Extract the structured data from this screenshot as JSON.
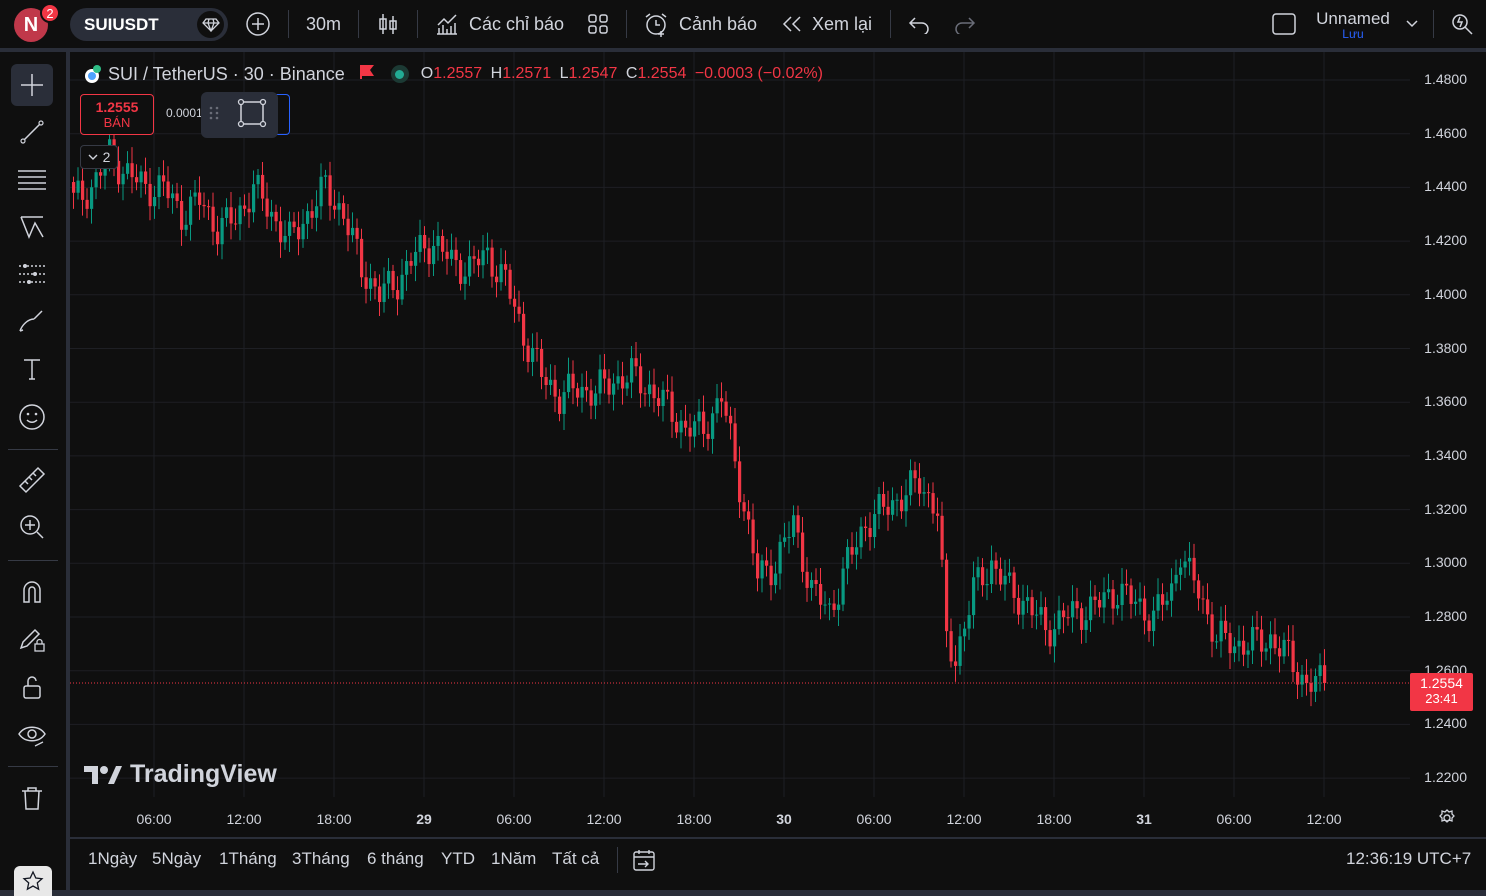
{
  "topbar": {
    "avatar_letter": "N",
    "notification_count": "2",
    "symbol": "SUIUSDT",
    "interval": "30m",
    "indicators_label": "Các chỉ báo",
    "alerts_label": "Cảnh báo",
    "replay_label": "Xem lại",
    "layout_name": "Unnamed",
    "save_label": "Lưu"
  },
  "legend": {
    "title": "SUI / TetherUS · 30 · Binance",
    "open_label": "O",
    "open": "1.2557",
    "high_label": "H",
    "high": "1.2571",
    "low_label": "L",
    "low": "1.2547",
    "close_label": "C",
    "close": "1.2554",
    "change": "−0.0003 (−0.02%)"
  },
  "trade": {
    "sell_price": "1.2555",
    "sell_label": "BÁN",
    "spread": "0.0001",
    "collapse_count": "2"
  },
  "price_axis": {
    "ticks": [
      "1.4800",
      "1.4600",
      "1.4400",
      "1.4200",
      "1.4000",
      "1.3800",
      "1.3600",
      "1.3400",
      "1.3200",
      "1.3000",
      "1.2800",
      "1.2600",
      "1.2400",
      "1.2200"
    ],
    "current_price": "1.2554",
    "countdown": "23:41"
  },
  "time_axis": {
    "ticks": [
      "06:00",
      "12:00",
      "18:00",
      "29",
      "06:00",
      "12:00",
      "18:00",
      "30",
      "06:00",
      "12:00",
      "18:00",
      "31",
      "06:00",
      "12:00"
    ]
  },
  "watermark": "TradingView",
  "bottombar": {
    "ranges": [
      "1Ngày",
      "5Ngày",
      "1Tháng",
      "3Tháng",
      "6 tháng",
      "YTD",
      "1Năm",
      "Tất cả"
    ],
    "clock": "12:36:19 UTC+7"
  },
  "colors": {
    "up": "#089981",
    "down": "#f23645",
    "background": "#0f0f0f",
    "accent": "#2962ff"
  },
  "chart_data": {
    "type": "candlestick",
    "ylim": [
      1.21,
      1.495
    ],
    "anchors": [
      [
        0,
        1.435
      ],
      [
        4,
        1.44
      ],
      [
        8,
        1.452
      ],
      [
        12,
        1.445
      ],
      [
        16,
        1.44
      ],
      [
        20,
        1.44
      ],
      [
        24,
        1.43
      ],
      [
        28,
        1.435
      ],
      [
        32,
        1.425
      ],
      [
        36,
        1.428
      ],
      [
        40,
        1.44
      ],
      [
        44,
        1.43
      ],
      [
        48,
        1.42
      ],
      [
        52,
        1.43
      ],
      [
        56,
        1.44
      ],
      [
        60,
        1.43
      ],
      [
        64,
        1.41
      ],
      [
        68,
        1.4
      ],
      [
        72,
        1.405
      ],
      [
        76,
        1.415
      ],
      [
        80,
        1.42
      ],
      [
        84,
        1.412
      ],
      [
        88,
        1.41
      ],
      [
        92,
        1.415
      ],
      [
        96,
        1.405
      ],
      [
        100,
        1.385
      ],
      [
        104,
        1.37
      ],
      [
        108,
        1.362
      ],
      [
        112,
        1.365
      ],
      [
        116,
        1.364
      ],
      [
        120,
        1.368
      ],
      [
        124,
        1.37
      ],
      [
        128,
        1.365
      ],
      [
        132,
        1.358
      ],
      [
        136,
        1.35
      ],
      [
        140,
        1.35
      ],
      [
        144,
        1.362
      ],
      [
        148,
        1.33
      ],
      [
        152,
        1.295
      ],
      [
        156,
        1.3
      ],
      [
        160,
        1.315
      ],
      [
        164,
        1.29
      ],
      [
        168,
        1.282
      ],
      [
        172,
        1.3
      ],
      [
        176,
        1.315
      ],
      [
        180,
        1.32
      ],
      [
        184,
        1.325
      ],
      [
        188,
        1.33
      ],
      [
        192,
        1.32
      ],
      [
        194,
        1.27
      ],
      [
        196,
        1.265
      ],
      [
        200,
        1.29
      ],
      [
        204,
        1.3
      ],
      [
        208,
        1.29
      ],
      [
        212,
        1.285
      ],
      [
        216,
        1.275
      ],
      [
        220,
        1.28
      ],
      [
        224,
        1.282
      ],
      [
        228,
        1.285
      ],
      [
        232,
        1.29
      ],
      [
        236,
        1.285
      ],
      [
        240,
        1.28
      ],
      [
        244,
        1.29
      ],
      [
        246,
        1.305
      ],
      [
        248,
        1.295
      ],
      [
        250,
        1.29
      ],
      [
        254,
        1.272
      ],
      [
        258,
        1.27
      ],
      [
        262,
        1.27
      ],
      [
        266,
        1.272
      ],
      [
        270,
        1.265
      ],
      [
        274,
        1.255
      ],
      [
        278,
        1.2555
      ]
    ]
  }
}
